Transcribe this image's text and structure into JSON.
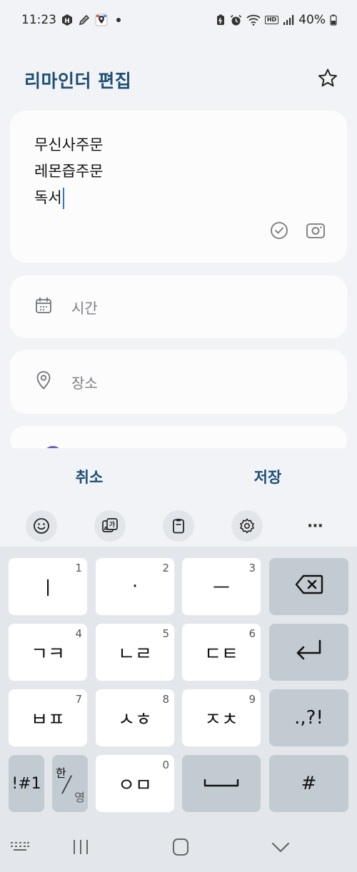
{
  "status_bar": {
    "time": "11:23",
    "battery": "40%",
    "hd_label": "HD"
  },
  "header": {
    "title": "리마인더 편집",
    "favorite_icon": "star-outline-icon"
  },
  "note": {
    "lines": [
      "무신사주문",
      "레몬즙주문",
      "독서"
    ]
  },
  "time_row": {
    "label": "시간",
    "icon": "calendar-icon"
  },
  "place_row": {
    "label": "장소",
    "icon": "location-pin-icon"
  },
  "actions": {
    "cancel": "취소",
    "save": "저장"
  },
  "keyboard_toolbar": {
    "items": [
      "emoji-icon",
      "translate-icon",
      "clipboard-icon",
      "settings-icon"
    ],
    "more": "⋯"
  },
  "keyboard": {
    "row1": [
      {
        "label": "ㅣ",
        "num": "1"
      },
      {
        "label": "·",
        "num": "2"
      },
      {
        "label": "ㅡ",
        "num": "3"
      }
    ],
    "row2": [
      {
        "label": "ㄱㅋ",
        "num": "4"
      },
      {
        "label": "ㄴㄹ",
        "num": "5"
      },
      {
        "label": "ㄷㅌ",
        "num": "6"
      }
    ],
    "row3": [
      {
        "label": "ㅂㅍ",
        "num": "7"
      },
      {
        "label": "ㅅㅎ",
        "num": "8"
      },
      {
        "label": "ㅈㅊ",
        "num": "9"
      }
    ],
    "punct": ".,?!",
    "symbols": "!#1",
    "lang_top": "한",
    "lang_bottom": "영",
    "row4_mid": {
      "label": "ㅇㅁ",
      "num": "0"
    },
    "hash": "#"
  },
  "colors": {
    "accent": "#1e4e72",
    "cursor": "#2b77d4",
    "key_dark": "#c3cbd2"
  }
}
